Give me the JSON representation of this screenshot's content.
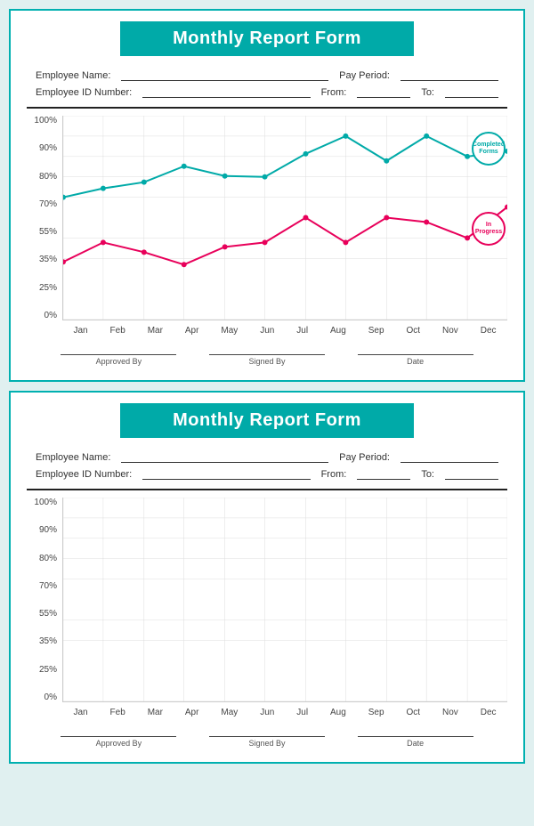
{
  "cards": [
    {
      "id": "card1",
      "title": "Monthly Report Form",
      "fields": {
        "employee_name_label": "Employee Name:",
        "employee_id_label": "Employee ID Number:",
        "pay_period_label": "Pay Period:",
        "from_label": "From:",
        "to_label": "To:"
      },
      "chart": {
        "y_labels": [
          "100%",
          "90%",
          "80%",
          "70%",
          "55%",
          "35%",
          "25%",
          "0%"
        ],
        "x_labels": [
          "Jan",
          "Feb",
          "Mar",
          "Apr",
          "May",
          "Jun",
          "Jul",
          "Aug",
          "Sep",
          "Oct",
          "Nov",
          "Dec"
        ],
        "completed_series": [
          60,
          63,
          65,
          75,
          68,
          70,
          85,
          90,
          78,
          90,
          82,
          85
        ],
        "inprogress_series": [
          28,
          38,
          33,
          27,
          37,
          38,
          50,
          38,
          50,
          48,
          40,
          55
        ],
        "legend_completed": "Completed Forms",
        "legend_inprogress": "In Progress"
      },
      "signatures": {
        "approved_by": "Approved By",
        "signed_by": "Signed By",
        "date": "Date"
      }
    },
    {
      "id": "card2",
      "title": "Monthly Report Form",
      "fields": {
        "employee_name_label": "Employee Name:",
        "employee_id_label": "Employee ID Number:",
        "pay_period_label": "Pay Period:",
        "from_label": "From:",
        "to_label": "To:"
      },
      "chart": {
        "y_labels": [
          "100%",
          "90%",
          "80%",
          "70%",
          "55%",
          "35%",
          "25%",
          "0%"
        ],
        "x_labels": [
          "Jan",
          "Feb",
          "Mar",
          "Apr",
          "May",
          "Jun",
          "Jul",
          "Aug",
          "Sep",
          "Oct",
          "Nov",
          "Dec"
        ],
        "completed_series": [],
        "inprogress_series": []
      },
      "signatures": {
        "approved_by": "Approved By",
        "signed_by": "Signed By",
        "date": "Date"
      }
    }
  ]
}
